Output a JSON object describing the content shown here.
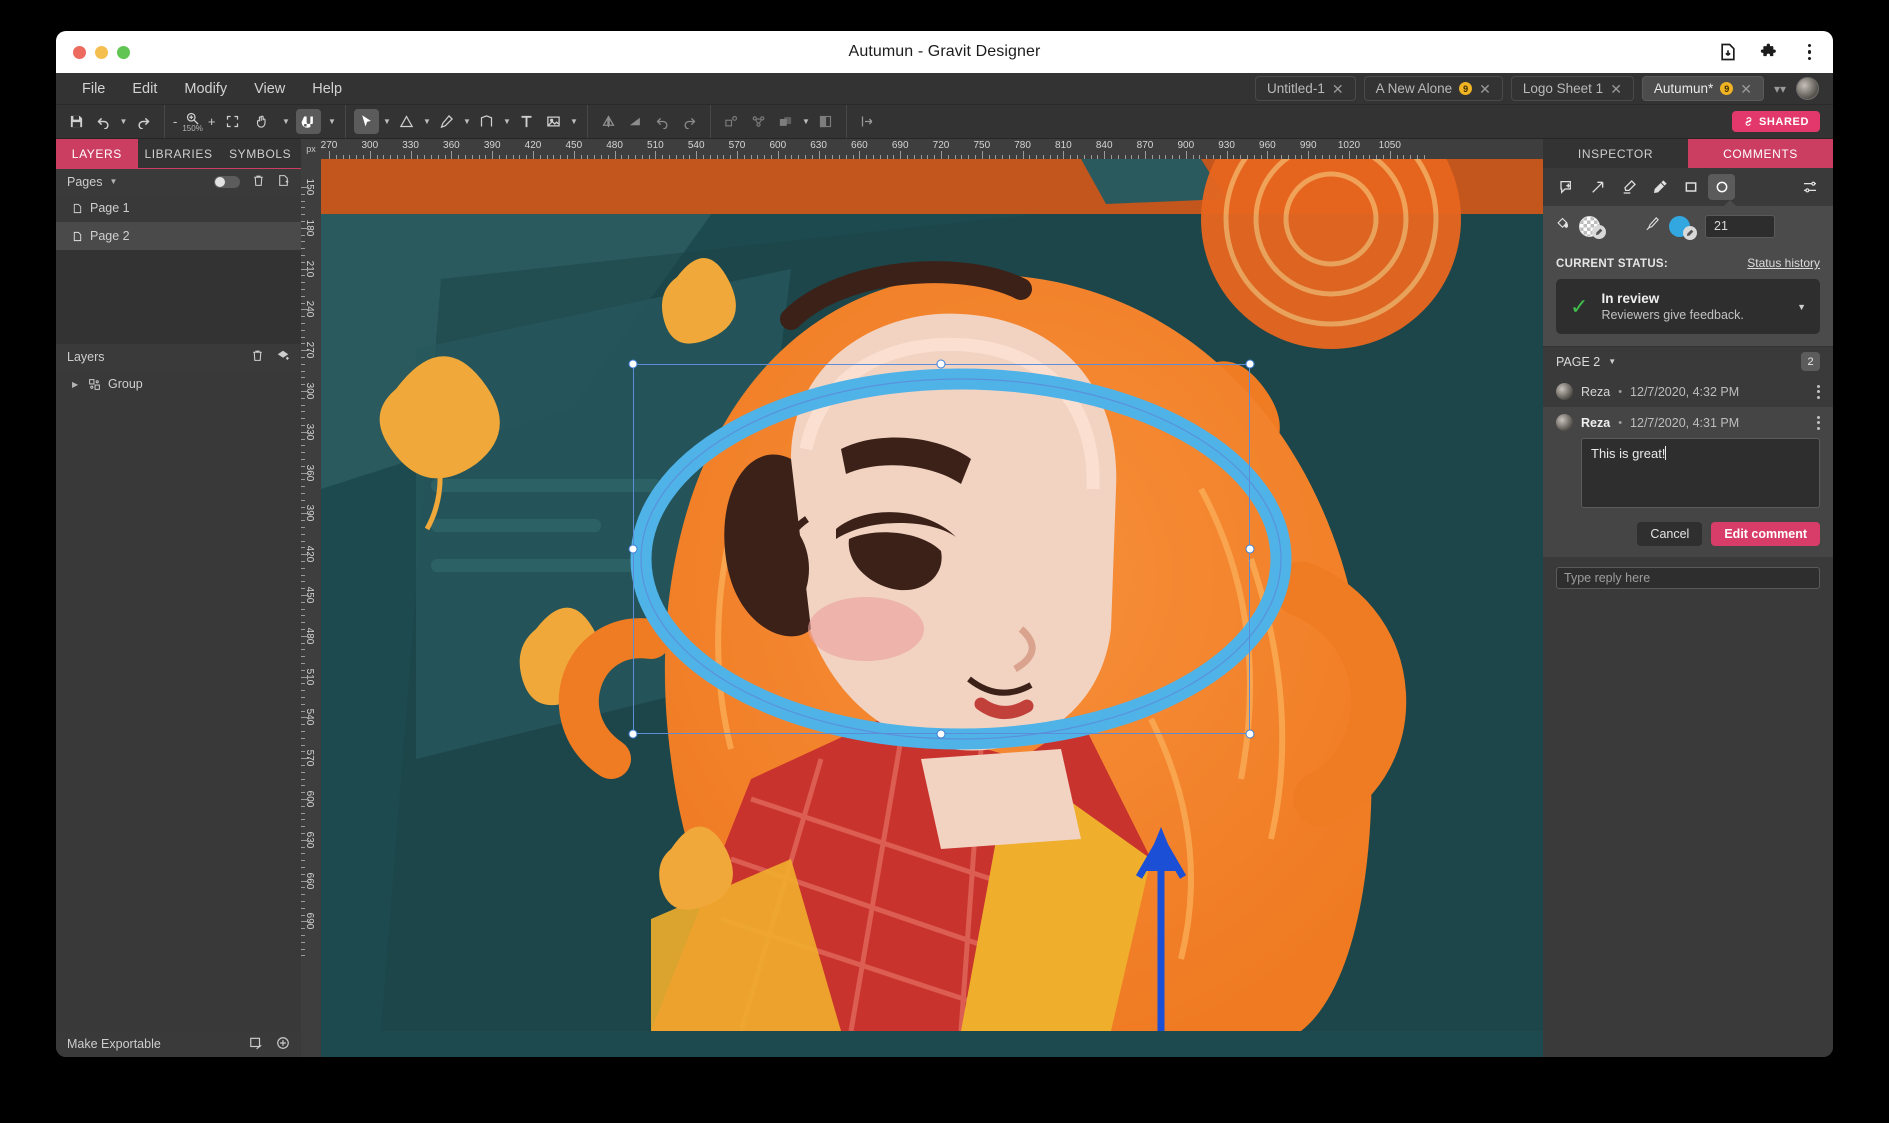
{
  "window": {
    "title": "Autumun - Gravit Designer",
    "traffic_lights": [
      "close",
      "minimize",
      "maximize"
    ],
    "actions": [
      "download-icon",
      "extension-icon",
      "browser-menu-icon"
    ]
  },
  "menubar": {
    "items": [
      "File",
      "Edit",
      "Modify",
      "View",
      "Help"
    ]
  },
  "tabs": [
    {
      "label": "Untitled-1",
      "badge": "",
      "active": false
    },
    {
      "label": "A New Alone",
      "badge": "9",
      "active": false
    },
    {
      "label": "Logo Sheet 1",
      "badge": "",
      "active": false
    },
    {
      "label": "Autumun*",
      "badge": "9",
      "active": true
    }
  ],
  "toolbar": {
    "zoom_level": "150%",
    "zoom_out": "-",
    "zoom_in": "+",
    "shared_label": "SHARED",
    "icons": [
      "save-icon",
      "undo-icon",
      "redo-icon",
      "zoom-icon",
      "fit-icon",
      "hand-icon",
      "magnet-icon",
      "pointer-icon",
      "shape-icon",
      "pen-icon",
      "bezigon-icon",
      "text-icon",
      "image-icon",
      "flip-horizontal-icon",
      "flip-vertical-icon",
      "rotate-left-icon",
      "rotate-right-icon",
      "path-union-icon",
      "path-knife-icon",
      "boolean-icon",
      "mask-icon",
      "align-left-icon",
      "align-right-icon",
      "distribute-icon",
      "crop-icon",
      "export-icon"
    ]
  },
  "left_panel": {
    "tabs": [
      {
        "label": "LAYERS",
        "active": true
      },
      {
        "label": "LIBRARIES",
        "active": false
      },
      {
        "label": "SYMBOLS",
        "active": false
      }
    ],
    "pages_header": {
      "label": "Pages",
      "icons": [
        "toggle-switch",
        "trash-icon",
        "add-page-icon"
      ]
    },
    "pages": [
      {
        "label": "Page 1",
        "selected": false
      },
      {
        "label": "Page 2",
        "selected": true
      }
    ],
    "layers_header": {
      "label": "Layers",
      "icons": [
        "trash-icon",
        "add-layer-icon"
      ]
    },
    "layers": [
      {
        "label": "Group",
        "selected": false
      }
    ],
    "footer": {
      "label": "Make Exportable",
      "icons": [
        "slice-icon",
        "add-circle-icon"
      ]
    }
  },
  "rulers": {
    "unit": "px",
    "horizontal_ticks": [
      270,
      300,
      330,
      360,
      390,
      420,
      450,
      480,
      510,
      540,
      570,
      600,
      630,
      660,
      690,
      720,
      750,
      780,
      810,
      840,
      870,
      900,
      930,
      960,
      990,
      1020,
      1050
    ],
    "vertical_ticks": [
      150,
      180,
      210,
      240,
      270,
      300,
      330,
      360,
      390,
      420,
      450,
      480,
      510,
      540,
      570,
      600,
      630,
      660,
      690
    ]
  },
  "right_panel": {
    "tabs": [
      {
        "label": "INSPECTOR",
        "active": false
      },
      {
        "label": "COMMENTS",
        "active": true
      }
    ],
    "annotation_tools": [
      {
        "name": "comment-pin-icon",
        "active": false
      },
      {
        "name": "arrow-icon",
        "active": false
      },
      {
        "name": "highlighter-icon",
        "active": false
      },
      {
        "name": "marker-pen-icon",
        "active": false
      },
      {
        "name": "rectangle-icon",
        "active": false
      },
      {
        "name": "ellipse-icon",
        "active": true
      },
      {
        "name": "settings-sliders-icon",
        "active": false
      }
    ],
    "properties": {
      "fill_icon": "paint-bucket-icon",
      "fill_swatch": "transparent",
      "stroke_icon": "pen-nib-icon",
      "stroke_color": "#33a8e0",
      "stroke_width": "21"
    },
    "status": {
      "label": "CURRENT STATUS:",
      "history_link": "Status history",
      "title": "In review",
      "subtitle": "Reviewers give feedback."
    },
    "page_section": {
      "label": "PAGE 2",
      "count": "2"
    },
    "comments": [
      {
        "author": "Reza",
        "separator": "•",
        "timestamp": "12/7/2020, 4:32 PM",
        "editing": false
      },
      {
        "author": "Reza",
        "separator": "•",
        "timestamp": "12/7/2020, 4:31 PM",
        "editing": true,
        "text": "This is great!"
      }
    ],
    "edit_actions": {
      "cancel": "Cancel",
      "submit": "Edit comment"
    },
    "reply_placeholder": "Type reply here"
  },
  "colors": {
    "accent_pink": "#cc3d62",
    "primary_button": "#d83c68",
    "selection_blue": "#3f7fd6",
    "annotation_blue": "#33a8e0",
    "status_green": "#3fbf4c",
    "canvas_teal": "#1d4a4e",
    "hair_orange": "#f07f2c",
    "panel_bg": "#333333"
  }
}
